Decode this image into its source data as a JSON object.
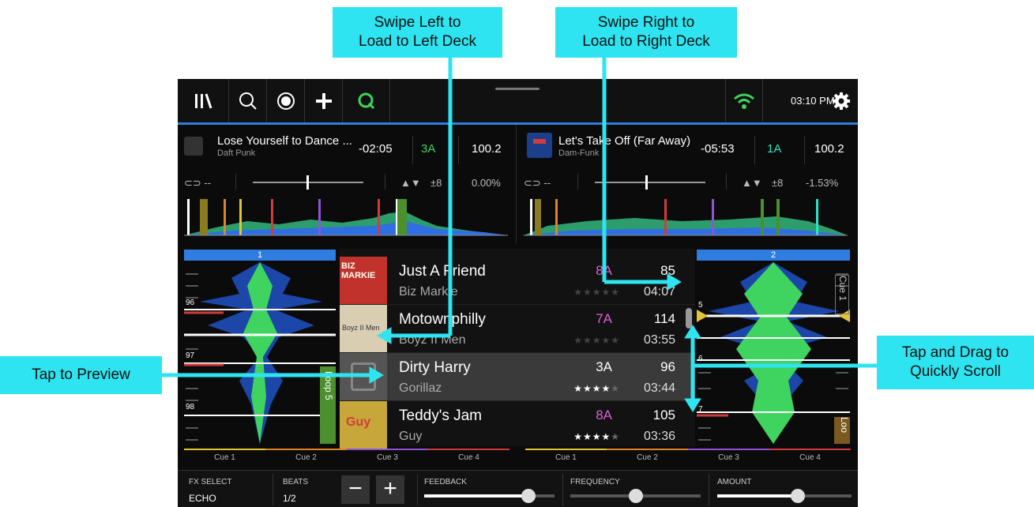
{
  "callouts": {
    "swipe_left_line1": "Swipe Left to",
    "swipe_left_line2": "Load to Left Deck",
    "swipe_right_line1": "Swipe Right to",
    "swipe_right_line2": "Load to Right Deck",
    "tap_preview": "Tap to Preview",
    "tap_drag_line1": "Tap and Drag to",
    "tap_drag_line2": "Quickly Scroll"
  },
  "topbar": {
    "icons": [
      "library-icon",
      "search-icon",
      "record-icon",
      "split-icon",
      "sync-icon",
      "wifi-icon",
      "gear-icon"
    ],
    "time": "03:10 PM",
    "accent": "#2f7de1"
  },
  "deck_left": {
    "title": "Lose Yourself to Dance ...",
    "artist": "Daft Punk",
    "remaining": "-02:05",
    "key": "3A",
    "key_color": "#3fd35f",
    "bpm": "100.2",
    "loop": "--",
    "range": "±8",
    "pitch": "0.00%",
    "number": "1"
  },
  "deck_right": {
    "title": "Let's Take Off (Far Away)",
    "artist": "Dam-Funk",
    "remaining": "-05:53",
    "key": "1A",
    "key_color": "#2ee4c4",
    "bpm": "100.2",
    "loop": "--",
    "range": "±8",
    "pitch": "-1.53%",
    "number": "2"
  },
  "library": {
    "rows": [
      {
        "title": "Just A Friend",
        "artist": "Biz Markie",
        "key": "8A",
        "key_color": "#e05fd8",
        "bpm": "85",
        "duration": "04:07",
        "stars": "★★★★★",
        "rated": 0
      },
      {
        "title": "Motownphilly",
        "artist": "Boyz II Men",
        "key": "7A",
        "key_color": "#e05fd8",
        "bpm": "114",
        "duration": "03:55",
        "stars": "★★★★★",
        "rated": 0
      },
      {
        "title": "Dirty Harry",
        "artist": "Gorillaz",
        "key": "3A",
        "key_color": "#ffffff",
        "bpm": "96",
        "duration": "03:44",
        "stars": "★★★★★",
        "rated": 4
      },
      {
        "title": "Teddy's Jam",
        "artist": "Guy",
        "key": "8A",
        "key_color": "#e05fd8",
        "bpm": "105",
        "duration": "03:36",
        "stars": "★★★★★",
        "rated": 4
      }
    ],
    "art_captions": [
      "BIZ MARKIE",
      "Boyz II Men",
      "",
      "Guy"
    ]
  },
  "left_overview": {
    "beat_markers": [
      "96",
      "97",
      "98"
    ],
    "loop_label": "Loop 5"
  },
  "right_overview": {
    "beat_markers": [
      "5",
      "6",
      "7"
    ],
    "cue_label": "Cue 1",
    "loop_label": "Loo"
  },
  "cues_left": [
    "Cue 1",
    "Cue 2",
    "Cue 3",
    "Cue 4"
  ],
  "cues_right": [
    "Cue 1",
    "Cue 2",
    "Cue 3",
    "Cue 4"
  ],
  "cue_colors": [
    "#e2c534",
    "#e0832c",
    "#8d55d6",
    "#d23b3b"
  ],
  "fx": {
    "select_label": "FX SELECT",
    "select_value": "ECHO",
    "beats_label": "BEATS",
    "beats_value": "1/2",
    "minus": "−",
    "plus": "+",
    "feedback_label": "FEEDBACK",
    "feedback_level": 0.8,
    "frequency_label": "FREQUENCY",
    "frequency_level": 0.5,
    "amount_label": "AMOUNT",
    "amount_level": 0.6
  }
}
